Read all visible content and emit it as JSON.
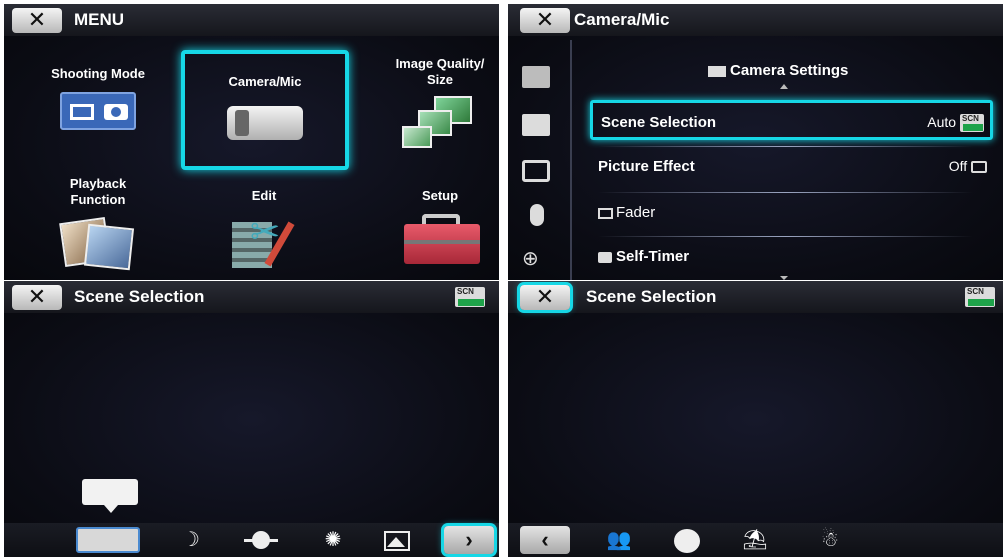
{
  "menu_screen": {
    "close_label": "✕",
    "title": "MENU",
    "tiles": [
      {
        "label": "Shooting Mode",
        "icon": "film-camera-icon"
      },
      {
        "label": "Camera/Mic",
        "icon": "camcorder-icon",
        "selected": true
      },
      {
        "label": "Image Quality/\nSize",
        "icon": "photos-stack-icon"
      },
      {
        "label": "Playback\nFunction",
        "icon": "photo-album-icon"
      },
      {
        "label": "Edit",
        "icon": "scissors-pencil-icon"
      },
      {
        "label": "Setup",
        "icon": "toolbox-icon"
      }
    ]
  },
  "camera_mic_screen": {
    "close_label": "✕",
    "title": "Camera/Mic",
    "section_title": "Camera Settings",
    "rows": [
      {
        "label": "Scene Selection",
        "value": "Auto"
      },
      {
        "label": "Picture Effect",
        "value": "Off"
      },
      {
        "label": "Fader",
        "value": ""
      },
      {
        "label": "Self-Timer",
        "value": ""
      }
    ],
    "scn_badge": {
      "text": "SCN",
      "sub": "AUTO"
    }
  },
  "scene_screen_1": {
    "close_label": "✕",
    "title": "Scene Selection",
    "scn_badge": {
      "text": "SCN",
      "sub": "AUTO"
    },
    "next_label": "›"
  },
  "scene_screen_2": {
    "close_label": "✕",
    "title": "Scene Selection",
    "scn_badge": {
      "text": "SCN",
      "sub": "AUTO"
    },
    "prev_label": "‹"
  },
  "colors": {
    "accent": "#16d7e6",
    "background": "#0b0c14",
    "auto_green": "#1ea34a"
  }
}
